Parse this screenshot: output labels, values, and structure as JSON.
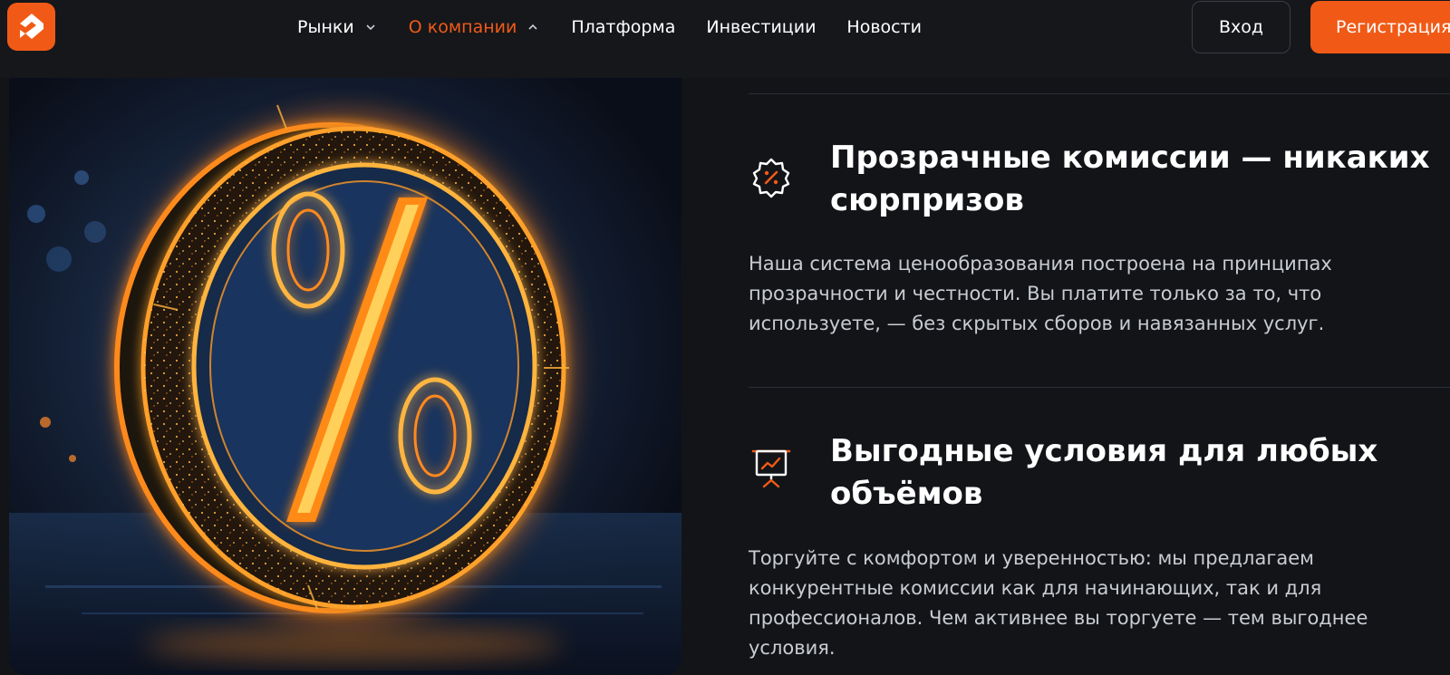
{
  "header": {
    "nav": [
      {
        "label": "Рынки",
        "has_chevron": true,
        "chevron": "chevron-down-icon"
      },
      {
        "label": "О компании",
        "has_chevron": true,
        "chevron": "chevron-up-icon",
        "active": true
      },
      {
        "label": "Платформа"
      },
      {
        "label": "Инвестиции"
      },
      {
        "label": "Новости"
      }
    ],
    "login_label": "Вход",
    "register_label": "Регистрация"
  },
  "features": [
    {
      "icon": "percent-badge-icon",
      "title": "Прозрачные комиссии — никаких сюрпризов",
      "text": "Наша система ценообразования построена на принципах прозрачности и честности. Вы платите только за то, что используете, — без скрытых сборов и навязанных услуг."
    },
    {
      "icon": "presentation-chart-icon",
      "title": "Выгодные условия для любых объёмов",
      "text": "Торгуйте с комфортом и уверенностью: мы предлагаем конкурентные комиссии как для начинающих, так и для профессионалов. Чем активнее вы торгуете — тем выгоднее условия."
    }
  ],
  "colors": {
    "accent": "#f15a16",
    "background": "#121418",
    "header": "#15171b",
    "text_muted": "#c9ccd1"
  }
}
